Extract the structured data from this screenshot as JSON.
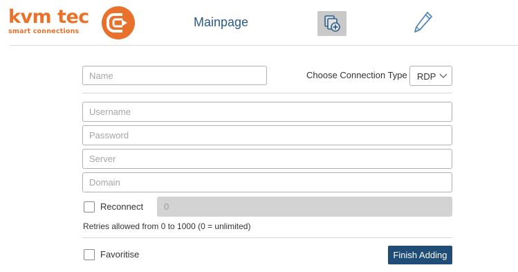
{
  "header": {
    "logo_text": "kvm tec",
    "logo_tagline": "smart connections",
    "nav_mainpage": "Mainpage",
    "add_icon": "add-connection-icon",
    "edit_icon": "pencil-icon",
    "brand_color": "#e8722b",
    "accent_color": "#1f4d77"
  },
  "form": {
    "name_placeholder": "Name",
    "connection_type_label": "Choose Connection Type",
    "connection_type_value": "RDP",
    "username_placeholder": "Username",
    "password_placeholder": "Password",
    "server_placeholder": "Server",
    "domain_placeholder": "Domain",
    "reconnect_label": "Reconnect",
    "retries_value": "0",
    "retries_help": "Retries allowed from 0 to 1000 (0 = unlimited)",
    "favoritise_label": "Favoritise",
    "finish_button": "Finish Adding"
  }
}
